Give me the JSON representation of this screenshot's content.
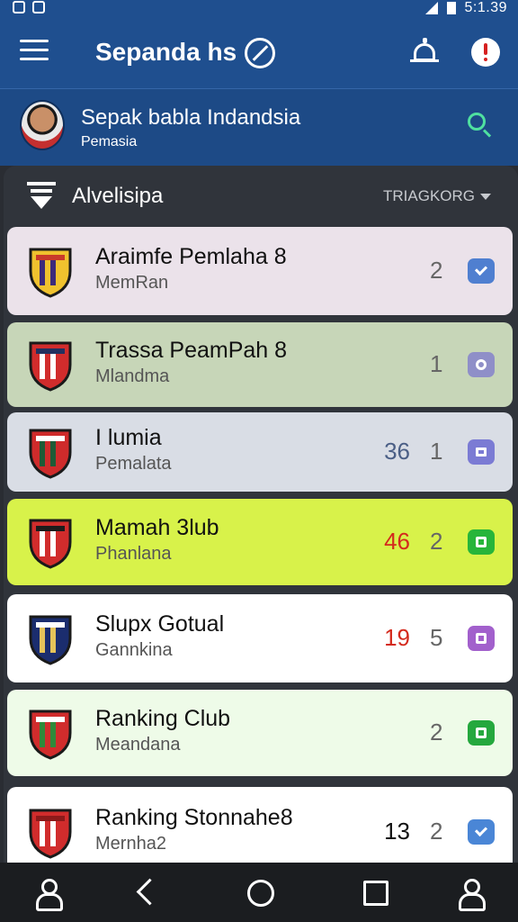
{
  "status": {
    "time": "5:1.39"
  },
  "app_bar": {
    "title": "Sepanda hs"
  },
  "profile": {
    "name": "Sepak babla Indandsia",
    "subtitle": "Pemasia"
  },
  "section": {
    "title": "Alvelisipa",
    "sort_label": "TRIAGKORG"
  },
  "rows": [
    {
      "name": "Araimfe Pemlaha 8",
      "sub": "MemRan",
      "score": "",
      "rank": "2",
      "badge": "check",
      "bg": "#ebe2ea",
      "badge_color": "#4f7fd0",
      "score_color": "#333"
    },
    {
      "name": "Trassa PeamPah 8",
      "sub": "Mlandma",
      "score": "",
      "rank": "1",
      "badge": "circle",
      "bg": "#c7d6b8",
      "badge_color": "#8f8fc8",
      "score_color": "#333"
    },
    {
      "name": "I lumia",
      "sub": "Pemalata",
      "score": "36",
      "rank": "1",
      "badge": "mail",
      "bg": "#d9dde5",
      "badge_color": "#7b7bd4",
      "score_color": "#4b5f86"
    },
    {
      "name": "Mamah 3lub",
      "sub": "Phanlana",
      "score": "46",
      "rank": "2",
      "badge": "square",
      "bg": "#d8f24a",
      "badge_color": "#27b53a",
      "score_color": "#d42a1d"
    },
    {
      "name": "Slupx Gotual",
      "sub": "Gannkina",
      "score": "19",
      "rank": "5",
      "badge": "square",
      "bg": "#ffffff",
      "badge_color": "#a260cc",
      "score_color": "#d42a1d"
    },
    {
      "name": "Ranking Club",
      "sub": "Meandana",
      "score": "",
      "rank": "2",
      "badge": "square",
      "bg": "#eefbe8",
      "badge_color": "#25a83e",
      "score_color": "#333"
    },
    {
      "name": "Ranking Stonnahe8",
      "sub": "Mernha2",
      "score": "13",
      "rank": "2",
      "badge": "check",
      "bg": "#ffffff",
      "badge_color": "#4a86d6",
      "score_color": "#111"
    }
  ],
  "crest_colors": [
    [
      "#f0c22e",
      "#3d2b7a",
      "#c93a2a"
    ],
    [
      "#d12c2c",
      "#ffffff",
      "#22315f"
    ],
    [
      "#cf2b2b",
      "#1e5b36",
      "#ffffff"
    ],
    [
      "#d12c2c",
      "#ffffff",
      "#1c1c1c"
    ],
    [
      "#1b2d6e",
      "#e5c35a",
      "#ffffff"
    ],
    [
      "#d12c2c",
      "#2f8a3a",
      "#ffffff"
    ],
    [
      "#d12c2c",
      "#ffffff",
      "#8c1a1a"
    ]
  ]
}
